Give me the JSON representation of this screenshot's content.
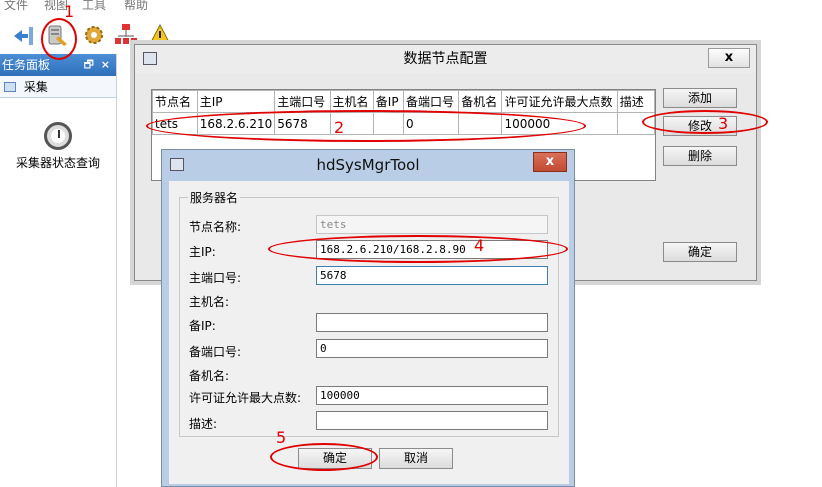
{
  "menubar": {
    "items": [
      "文件",
      "视图",
      "工具",
      "帮助"
    ]
  },
  "toolbar": {
    "icons": [
      "import-icon",
      "node-config-icon",
      "settings-gear-icon",
      "network-tree-icon",
      "alarm-icon"
    ]
  },
  "task_panel": {
    "title": "任务面板",
    "pin_glyph": "🗗",
    "close_glyph": "×",
    "group_label": "采集",
    "tool_label": "采集器状态查询"
  },
  "node_dialog": {
    "title": "数据节点配置",
    "close_label": "x",
    "columns": [
      "节点名",
      "主IP",
      "主端口号",
      "主机名",
      "备IP",
      "备端口号",
      "备机名",
      "许可证允许最大点数",
      "描述"
    ],
    "rows": [
      [
        "tets",
        "168.2.6.210",
        "5678",
        "",
        "",
        "0",
        "",
        "100000",
        ""
      ]
    ],
    "buttons": {
      "add": "添加",
      "modify": "修改",
      "delete": "删除",
      "ok": "确定"
    }
  },
  "edit_dialog": {
    "title": "hdSysMgrTool",
    "close_label": "x",
    "group_title": "服务器名",
    "fields": {
      "node_name": {
        "label": "节点名称:",
        "value": "tets"
      },
      "main_ip": {
        "label": "主IP:",
        "value": "168.2.6.210/168.2.8.90"
      },
      "main_port": {
        "label": "主端口号:",
        "value": "5678"
      },
      "main_host": {
        "label": "主机名:"
      },
      "backup_ip": {
        "label": "备IP:",
        "value": ""
      },
      "backup_port": {
        "label": "备端口号:",
        "value": "0"
      },
      "backup_host": {
        "label": "备机名:"
      },
      "license_max": {
        "label": "许可证允许最大点数:",
        "value": "100000"
      },
      "description": {
        "label": "描述:",
        "value": ""
      }
    },
    "buttons": {
      "ok": "确定",
      "cancel": "取消"
    }
  },
  "annotations": [
    "1",
    "2",
    "3",
    "4",
    "5"
  ],
  "colors": {
    "annotation": "#e00000",
    "panel_header": "#2f6fba",
    "dialog_frame": "#b9cde6"
  }
}
